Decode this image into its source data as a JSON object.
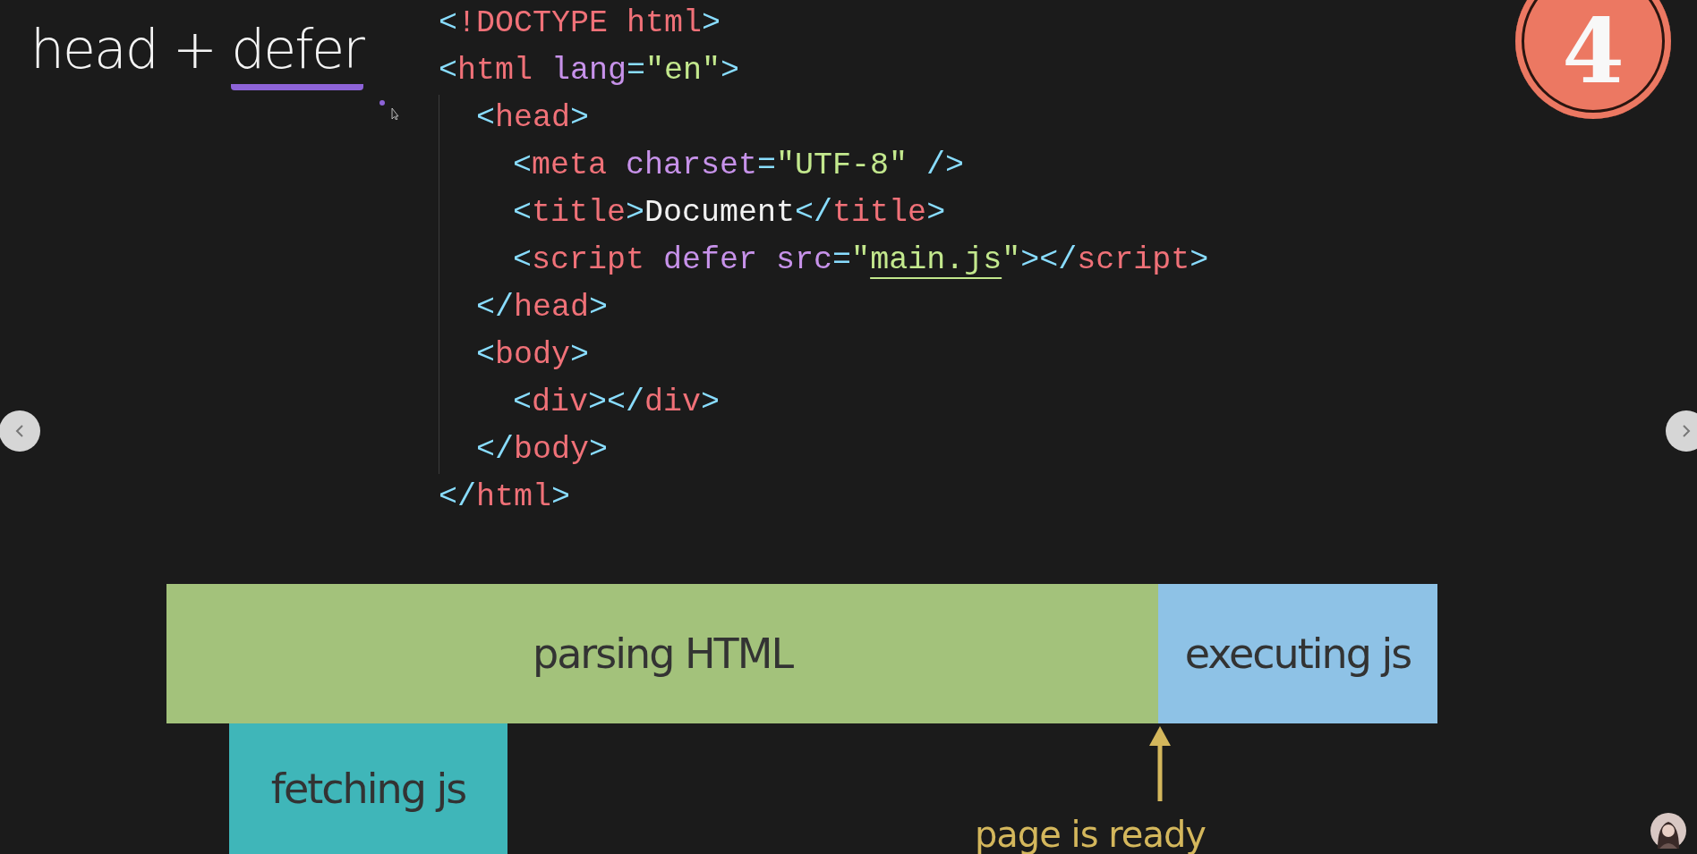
{
  "title": {
    "plain": "head + ",
    "underlined": "defer"
  },
  "badge": "4",
  "code": {
    "lines": [
      {
        "tokens": [
          {
            "kind": "punct",
            "text": "<"
          },
          {
            "kind": "tag",
            "text": "!DOCTYPE html"
          },
          {
            "kind": "punct",
            "text": ">"
          }
        ]
      },
      {
        "tokens": [
          {
            "kind": "punct",
            "text": "<"
          },
          {
            "kind": "tag",
            "text": "html"
          },
          {
            "kind": "attr",
            "text": " lang"
          },
          {
            "kind": "punct",
            "text": "="
          },
          {
            "kind": "str",
            "text": "\"en\""
          },
          {
            "kind": "punct",
            "text": ">"
          }
        ],
        "children": [
          {
            "tokens": [
              {
                "kind": "punct",
                "text": "<"
              },
              {
                "kind": "tag",
                "text": "head"
              },
              {
                "kind": "punct",
                "text": ">"
              }
            ],
            "children": [
              {
                "tokens": [
                  {
                    "kind": "punct",
                    "text": "<"
                  },
                  {
                    "kind": "tag",
                    "text": "meta"
                  },
                  {
                    "kind": "attr",
                    "text": " charset"
                  },
                  {
                    "kind": "punct",
                    "text": "="
                  },
                  {
                    "kind": "str",
                    "text": "\"UTF-8\""
                  },
                  {
                    "kind": "punct",
                    "text": " />"
                  }
                ]
              },
              {
                "tokens": [
                  {
                    "kind": "punct",
                    "text": "<"
                  },
                  {
                    "kind": "tag",
                    "text": "title"
                  },
                  {
                    "kind": "punct",
                    "text": ">"
                  },
                  {
                    "kind": "text",
                    "text": "Document"
                  },
                  {
                    "kind": "punct",
                    "text": "</"
                  },
                  {
                    "kind": "tag",
                    "text": "title"
                  },
                  {
                    "kind": "punct",
                    "text": ">"
                  }
                ]
              },
              {
                "tokens": [
                  {
                    "kind": "punct",
                    "text": "<"
                  },
                  {
                    "kind": "tag",
                    "text": "script"
                  },
                  {
                    "kind": "attr",
                    "text": " defer src"
                  },
                  {
                    "kind": "punct",
                    "text": "="
                  },
                  {
                    "kind": "str",
                    "text": "\""
                  },
                  {
                    "kind": "link",
                    "text": "main.js"
                  },
                  {
                    "kind": "str",
                    "text": "\""
                  },
                  {
                    "kind": "punct",
                    "text": "></"
                  },
                  {
                    "kind": "tag",
                    "text": "script"
                  },
                  {
                    "kind": "punct",
                    "text": ">"
                  }
                ]
              }
            ]
          },
          {
            "tokens": [
              {
                "kind": "punct",
                "text": "</"
              },
              {
                "kind": "tag",
                "text": "head"
              },
              {
                "kind": "punct",
                "text": ">"
              }
            ]
          },
          {
            "tokens": [
              {
                "kind": "punct",
                "text": "<"
              },
              {
                "kind": "tag",
                "text": "body"
              },
              {
                "kind": "punct",
                "text": ">"
              }
            ],
            "children": [
              {
                "tokens": [
                  {
                    "kind": "punct",
                    "text": "<"
                  },
                  {
                    "kind": "tag",
                    "text": "div"
                  },
                  {
                    "kind": "punct",
                    "text": "></"
                  },
                  {
                    "kind": "tag",
                    "text": "div"
                  },
                  {
                    "kind": "punct",
                    "text": ">"
                  }
                ]
              }
            ]
          },
          {
            "tokens": [
              {
                "kind": "punct",
                "text": "</"
              },
              {
                "kind": "tag",
                "text": "body"
              },
              {
                "kind": "punct",
                "text": ">"
              }
            ]
          }
        ]
      },
      {
        "tokens": [
          {
            "kind": "punct",
            "text": "</"
          },
          {
            "kind": "tag",
            "text": "html"
          },
          {
            "kind": "punct",
            "text": ">"
          }
        ]
      }
    ]
  },
  "timeline": {
    "rows": [
      {
        "segments": [
          {
            "label": "parsing HTML",
            "color": "#a3c27b"
          },
          {
            "label": "executing js",
            "color": "#8ec2e6"
          }
        ]
      },
      {
        "segments": [
          {
            "label": "fetching js",
            "color": "#3fb6b9"
          }
        ]
      }
    ],
    "marker": {
      "label": "page is ready"
    }
  }
}
